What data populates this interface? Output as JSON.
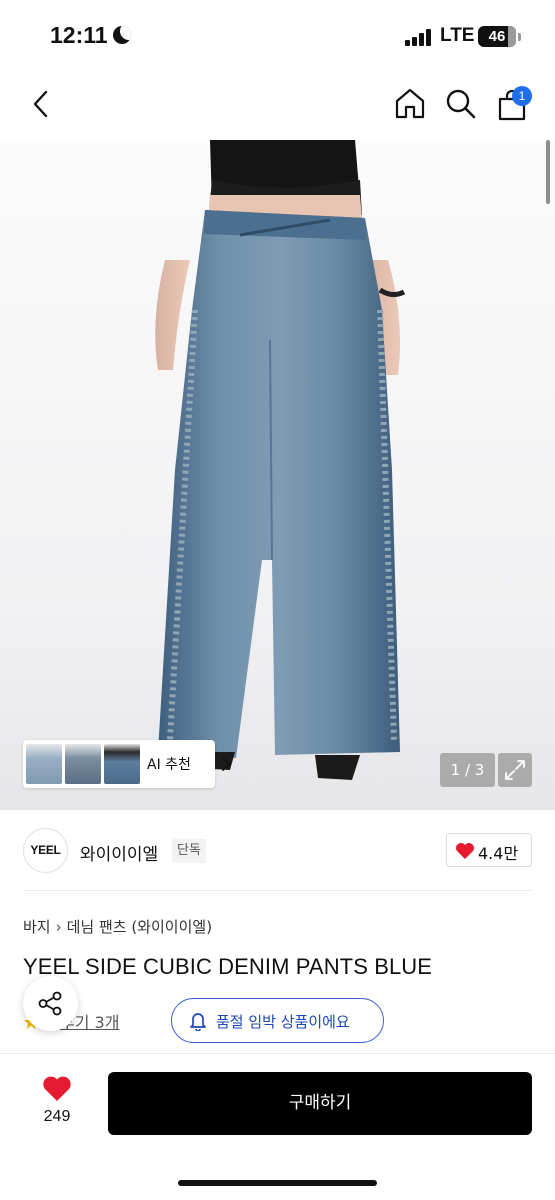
{
  "status_bar": {
    "time": "12:11",
    "network": "LTE",
    "battery": "46",
    "battery_level_percent": 46,
    "moon_icon": "moon-icon",
    "signal_icon": "signal-icon"
  },
  "nav": {
    "back_icon": "chevron-left-icon",
    "home_icon": "home-icon",
    "search_icon": "search-icon",
    "cart_icon": "shopping-bag-icon",
    "cart_badge": "1"
  },
  "gallery": {
    "ai_label": "AI 추천",
    "counter": "1 / 3",
    "expand_icon": "expand-icon"
  },
  "brand": {
    "logo_text": "YEEL",
    "name": "와이이이엘",
    "tag": "단독",
    "rating": "4.4만"
  },
  "breadcrumb": [
    "바지",
    "데님 팬츠 (와이이이엘)"
  ],
  "product": {
    "title": "YEEL SIDE CUBIC DENIM PANTS BLUE",
    "review_text": "후기 3개",
    "stock_alert": "품절 임박 상품이에요"
  },
  "bottom_bar": {
    "like_count": "249",
    "buy_label": "구매하기"
  },
  "colors": {
    "accent_blue": "#1f6feb",
    "alert_border": "#3a63d6",
    "heart_red": "#e5192f",
    "buy_button": "#000000"
  }
}
